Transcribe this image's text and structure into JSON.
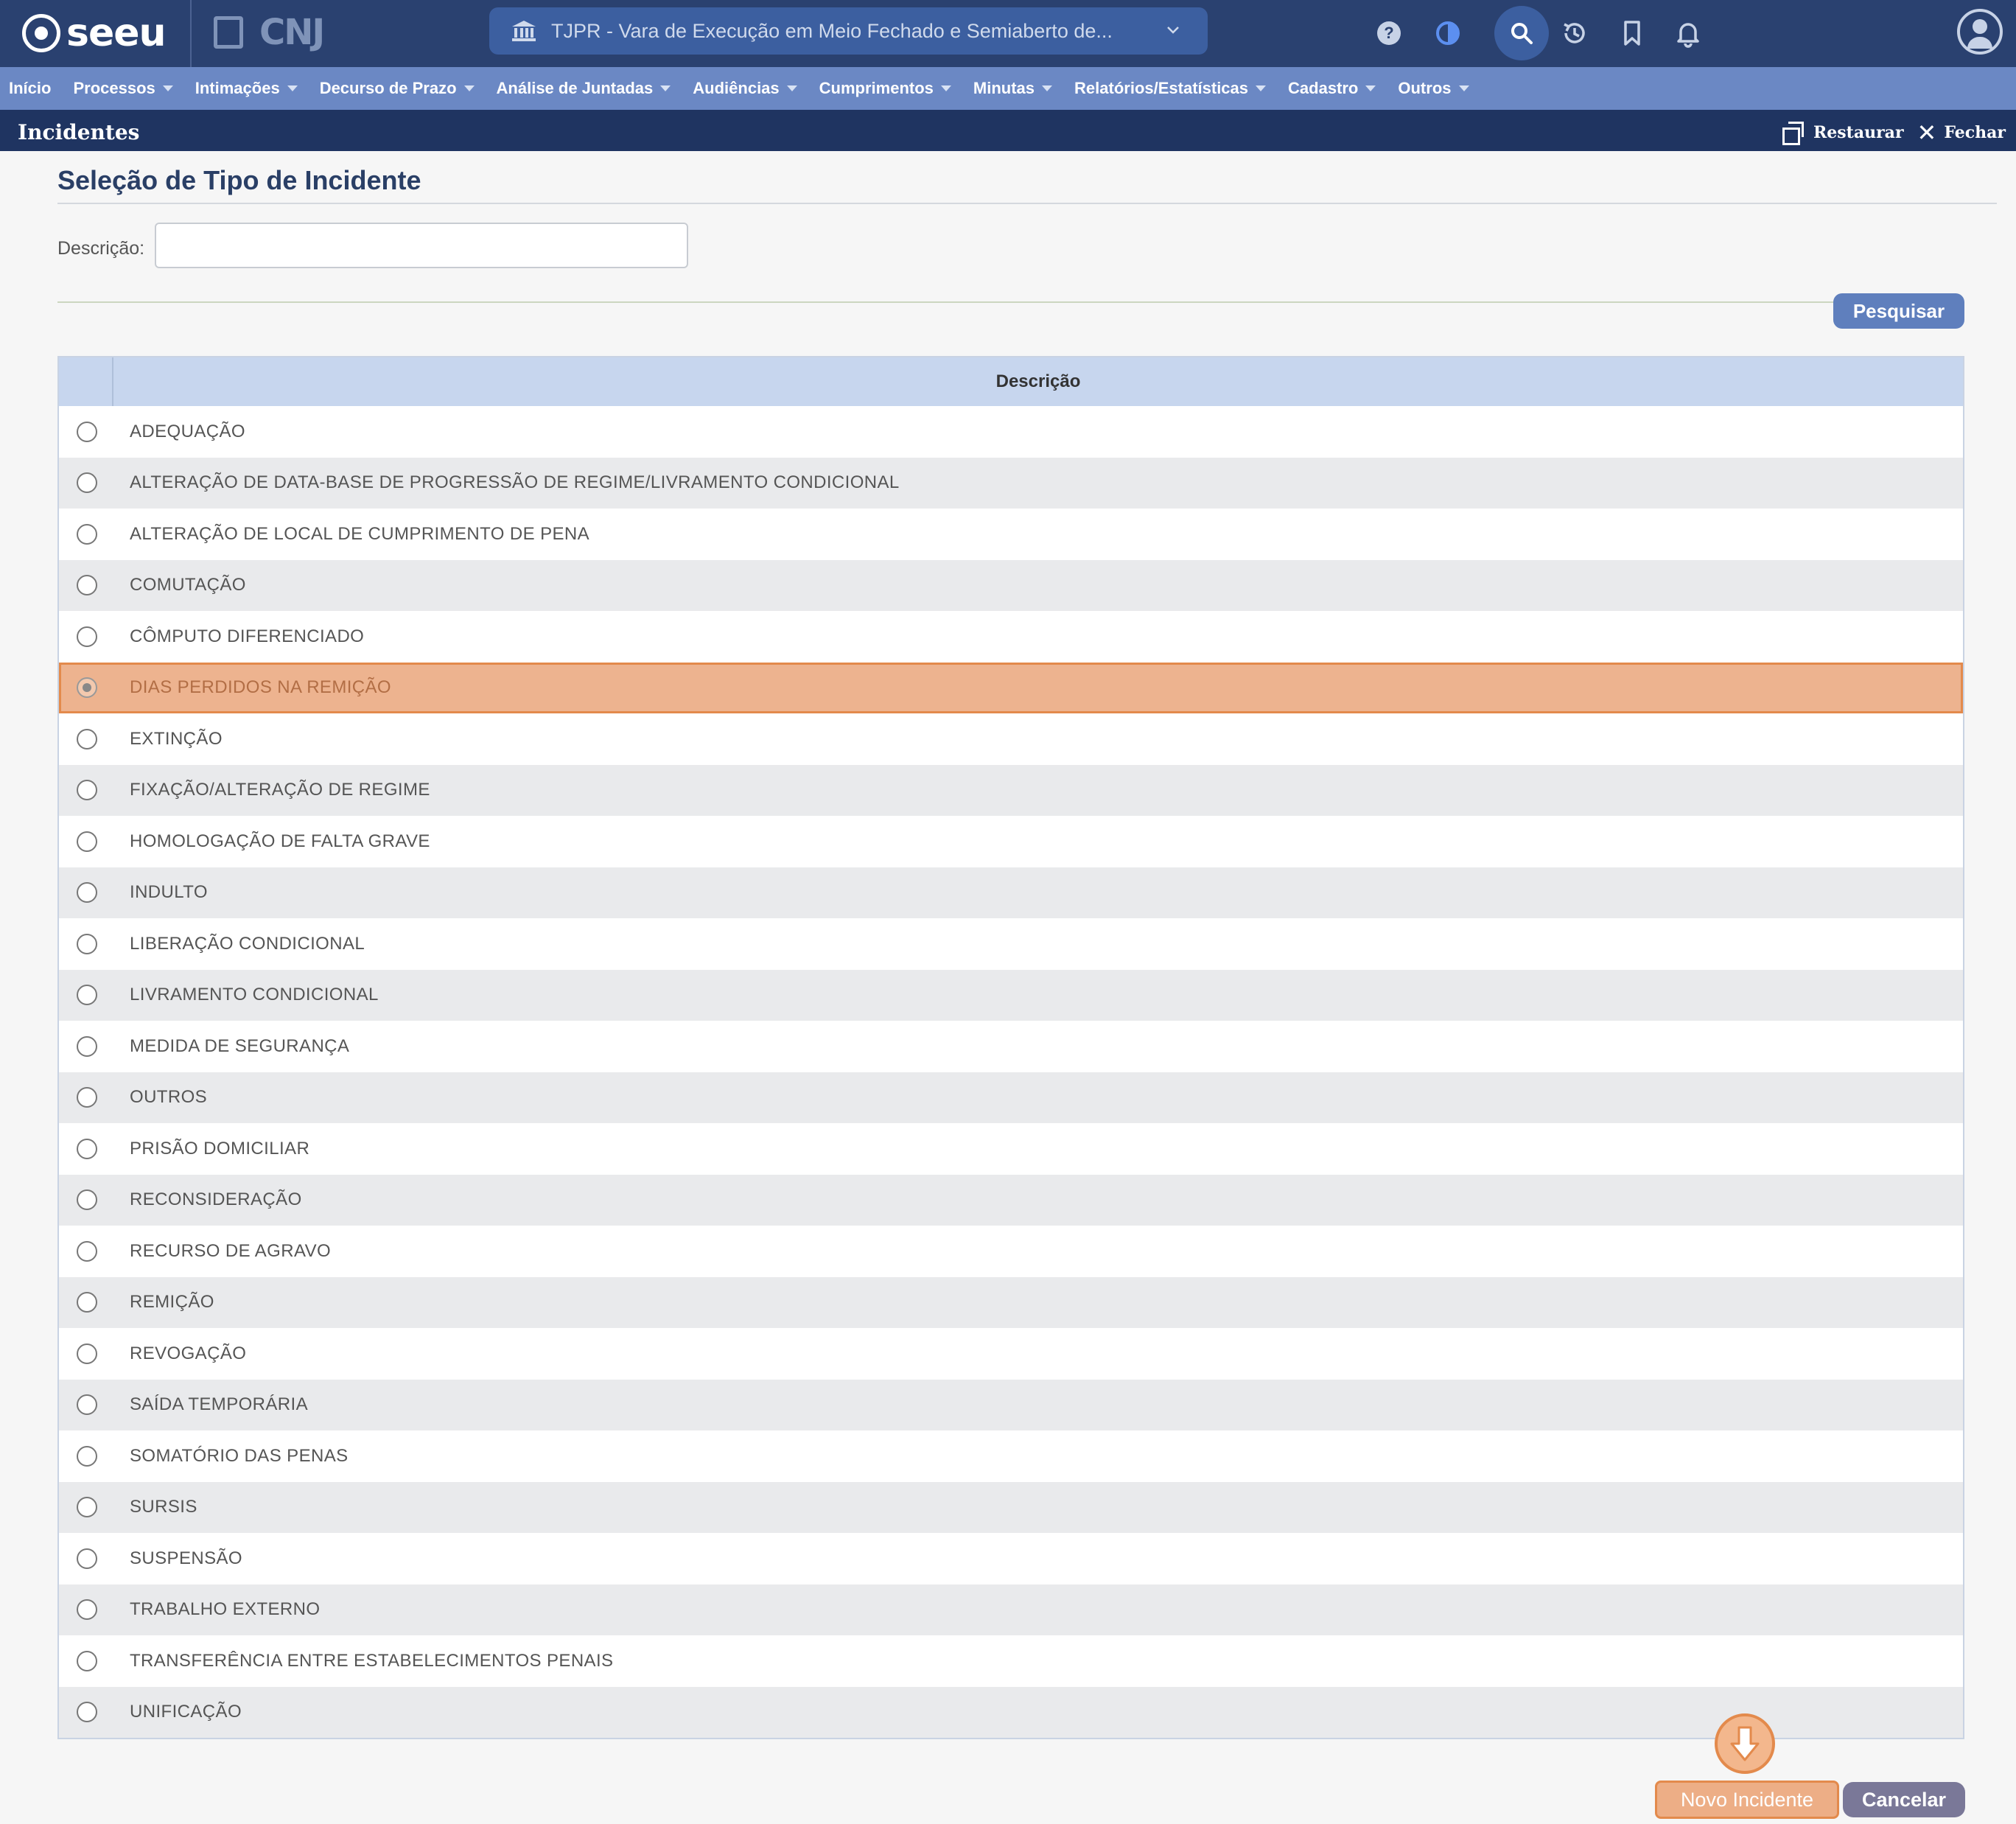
{
  "app": {
    "brand": "seeu",
    "partner_logo": "CNJ",
    "court_selector": "TJPR - Vara de Execução em Meio Fechado e Semiaberto de...",
    "icons": {
      "help": "help-circle-icon",
      "theme": "contrast-icon",
      "search": "search-icon",
      "history": "history-icon",
      "bookmark": "bookmark-icon",
      "notifications": "bell-icon",
      "user": "user-circle-icon"
    }
  },
  "menu": [
    {
      "label": "Início"
    },
    {
      "label": "Processos"
    },
    {
      "label": "Intimações"
    },
    {
      "label": "Decurso de Prazo"
    },
    {
      "label": "Análise de Juntadas"
    },
    {
      "label": "Audiências"
    },
    {
      "label": "Cumprimentos"
    },
    {
      "label": "Minutas"
    },
    {
      "label": "Relatórios/Estatísticas"
    },
    {
      "label": "Cadastro"
    },
    {
      "label": "Outros"
    }
  ],
  "panel": {
    "title": "Incidentes",
    "restore_label": "Restaurar",
    "close_label": "Fechar"
  },
  "form": {
    "title": "Seleção de Tipo de Incidente",
    "description_label": "Descrição:",
    "description_value": "",
    "search_button": "Pesquisar"
  },
  "table": {
    "header": "Descrição",
    "selected_index": 5,
    "rows": [
      "ADEQUAÇÃO",
      "ALTERAÇÃO DE DATA-BASE DE PROGRESSÃO DE REGIME/LIVRAMENTO CONDICIONAL",
      "ALTERAÇÃO DE LOCAL DE CUMPRIMENTO DE PENA",
      "COMUTAÇÃO",
      "CÔMPUTO DIFERENCIADO",
      "DIAS PERDIDOS NA REMIÇÃO",
      "EXTINÇÃO",
      "FIXAÇÃO/ALTERAÇÃO DE REGIME",
      "HOMOLOGAÇÃO DE FALTA GRAVE",
      "INDULTO",
      "LIBERAÇÃO CONDICIONAL",
      "LIVRAMENTO CONDICIONAL",
      "MEDIDA DE SEGURANÇA",
      "OUTROS",
      "PRISÃO DOMICILIAR",
      "RECONSIDERAÇÃO",
      "RECURSO DE AGRAVO",
      "REMIÇÃO",
      "REVOGAÇÃO",
      "SAÍDA TEMPORÁRIA",
      "SOMATÓRIO DAS PENAS",
      "SURSIS",
      "SUSPENSÃO",
      "TRABALHO EXTERNO",
      "TRANSFERÊNCIA ENTRE ESTABELECIMENTOS PENAIS",
      "UNIFICAÇÃO"
    ]
  },
  "actions": {
    "new_button": "Novo Incidente",
    "cancel_button": "Cancelar",
    "hint_icon": "arrow-down-icon"
  },
  "colors": {
    "topbar": "#2a4170",
    "menubar": "#6b88c4",
    "panel_header": "#1f3461",
    "highlight": "#edb38f",
    "highlight_border": "#e38a4c"
  }
}
